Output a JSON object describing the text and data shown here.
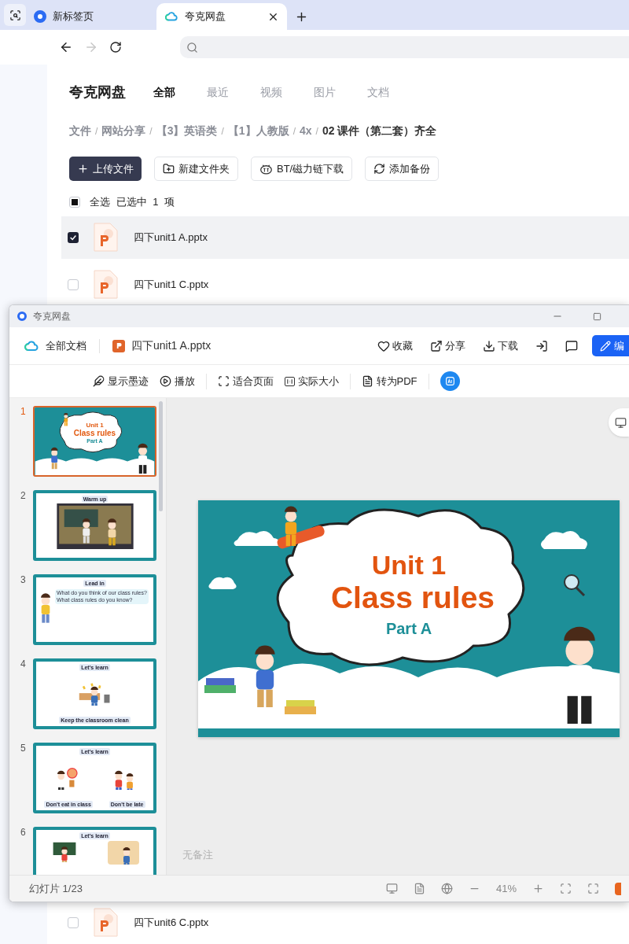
{
  "browser": {
    "tabs": [
      {
        "label": "新标签页",
        "selected": false
      },
      {
        "label": "夸克网盘",
        "selected": true
      }
    ]
  },
  "app": {
    "title": "夸克网盘",
    "nav": [
      {
        "label": "全部",
        "selected": true
      },
      {
        "label": "最近",
        "selected": false
      },
      {
        "label": "视频",
        "selected": false
      },
      {
        "label": "图片",
        "selected": false
      },
      {
        "label": "文档",
        "selected": false
      }
    ],
    "breadcrumb": [
      {
        "label": "文件",
        "kind": "link"
      },
      {
        "label": "/",
        "kind": "separator"
      },
      {
        "label": "网站分享",
        "kind": "link"
      },
      {
        "label": "/",
        "kind": "separator"
      },
      {
        "label": "【3】英语类",
        "kind": "link"
      },
      {
        "label": "/",
        "kind": "separator"
      },
      {
        "label": "【1】人教版",
        "kind": "link"
      },
      {
        "label": "/",
        "kind": "separator"
      },
      {
        "label": "4x",
        "kind": "link"
      },
      {
        "label": "/",
        "kind": "separator"
      },
      {
        "label": "02 课件（第二套）齐全",
        "kind": "current"
      }
    ],
    "actions": [
      {
        "label": "上传文件",
        "kind": "upload"
      },
      {
        "label": "新建文件夹",
        "kind": "folder"
      },
      {
        "label": "BT/磁力链下载",
        "kind": "bt"
      },
      {
        "label": "添加备份",
        "kind": "backup"
      }
    ],
    "select_all": {
      "label": "全选",
      "indeterminate": true,
      "summary": "已选中  1  项"
    },
    "files": [
      {
        "name": "四下unit1 A.pptx",
        "checked": true
      },
      {
        "name": "四下unit1 C.pptx",
        "checked": false
      }
    ],
    "files_below": [
      {
        "name": "四下unit6 C.pptx",
        "checked": false
      }
    ]
  },
  "viewer": {
    "window_title": "夸克网盘",
    "crumb": "全部文档",
    "file": "四下unit1 A.pptx",
    "actions": [
      {
        "label": "收藏",
        "kind": "heart"
      },
      {
        "label": "分享",
        "kind": "share"
      },
      {
        "label": "下载",
        "kind": "download"
      },
      {
        "kind": "export"
      },
      {
        "kind": "report"
      }
    ],
    "edit_button": "编",
    "toolbar": [
      {
        "label": "显示墨迹",
        "kind": "ink",
        "separator_after": false
      },
      {
        "label": "播放",
        "kind": "play",
        "separator_after": true
      },
      {
        "label": "适合页面",
        "kind": "fit",
        "separator_after": false
      },
      {
        "label": "实际大小",
        "kind": "actual",
        "separator_after": true
      },
      {
        "label": "转为PDF",
        "kind": "pdf",
        "separator_after": true
      },
      {
        "kind": "ai",
        "separator_after": false
      }
    ],
    "thumbnails": [
      {
        "number": "1",
        "selected": true,
        "kind": "title",
        "texts": [
          "Unit 1",
          "Class rules",
          "Part A"
        ]
      },
      {
        "number": "2",
        "selected": false,
        "kind": "video",
        "texts": [
          "Warm up"
        ]
      },
      {
        "number": "3",
        "selected": false,
        "kind": "bullets",
        "texts": [
          "Lead in",
          "What do you think of our class rules?",
          "What class rules do you know?"
        ]
      },
      {
        "number": "4",
        "selected": false,
        "kind": "single",
        "texts": [
          "Let's learn",
          "Keep the classroom clean"
        ]
      },
      {
        "number": "5",
        "selected": false,
        "kind": "pair",
        "texts": [
          "Let's learn",
          "Don't eat in class",
          "Don't be late"
        ]
      },
      {
        "number": "6",
        "selected": false,
        "kind": "cut",
        "texts": [
          "Let's learn"
        ]
      }
    ],
    "slide": {
      "title": "Unit 1",
      "subtitle": "Class rules",
      "part": "Part A"
    },
    "notes": "无备注",
    "status": {
      "slide_count": "幻灯片 1/23",
      "zoom": "41%"
    }
  }
}
